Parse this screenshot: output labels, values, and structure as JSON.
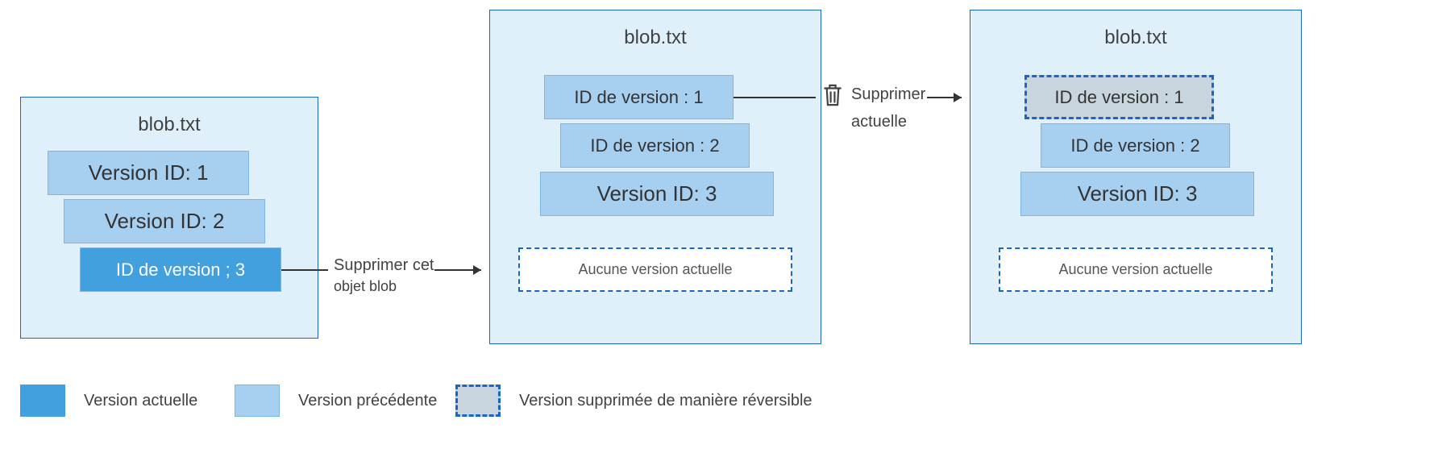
{
  "boxes": {
    "left": {
      "title": "blob.txt"
    },
    "mid": {
      "title": "blob.txt"
    },
    "right": {
      "title": "blob.txt"
    }
  },
  "left": {
    "v1": "Version ID: 1",
    "v2": "Version ID: 2",
    "v3": "ID de version ; 3"
  },
  "mid": {
    "v1": "ID de version : 1",
    "v2": "ID de version : 2",
    "v3": "Version ID: 3",
    "none": "Aucune version actuelle"
  },
  "right": {
    "v1": "ID de version : 1",
    "v2": "ID de version : 2",
    "v3": "Version ID: 3",
    "none": "Aucune version actuelle"
  },
  "actions": {
    "a1_line1": "Supprimer cet",
    "a1_line2": "objet blob",
    "a2_line1": "Supprimer",
    "a2_line2": "actuelle"
  },
  "legend": {
    "current": "Version actuelle",
    "previous": "Version précédente",
    "soft_deleted": "Version supprimée de manière réversible"
  }
}
